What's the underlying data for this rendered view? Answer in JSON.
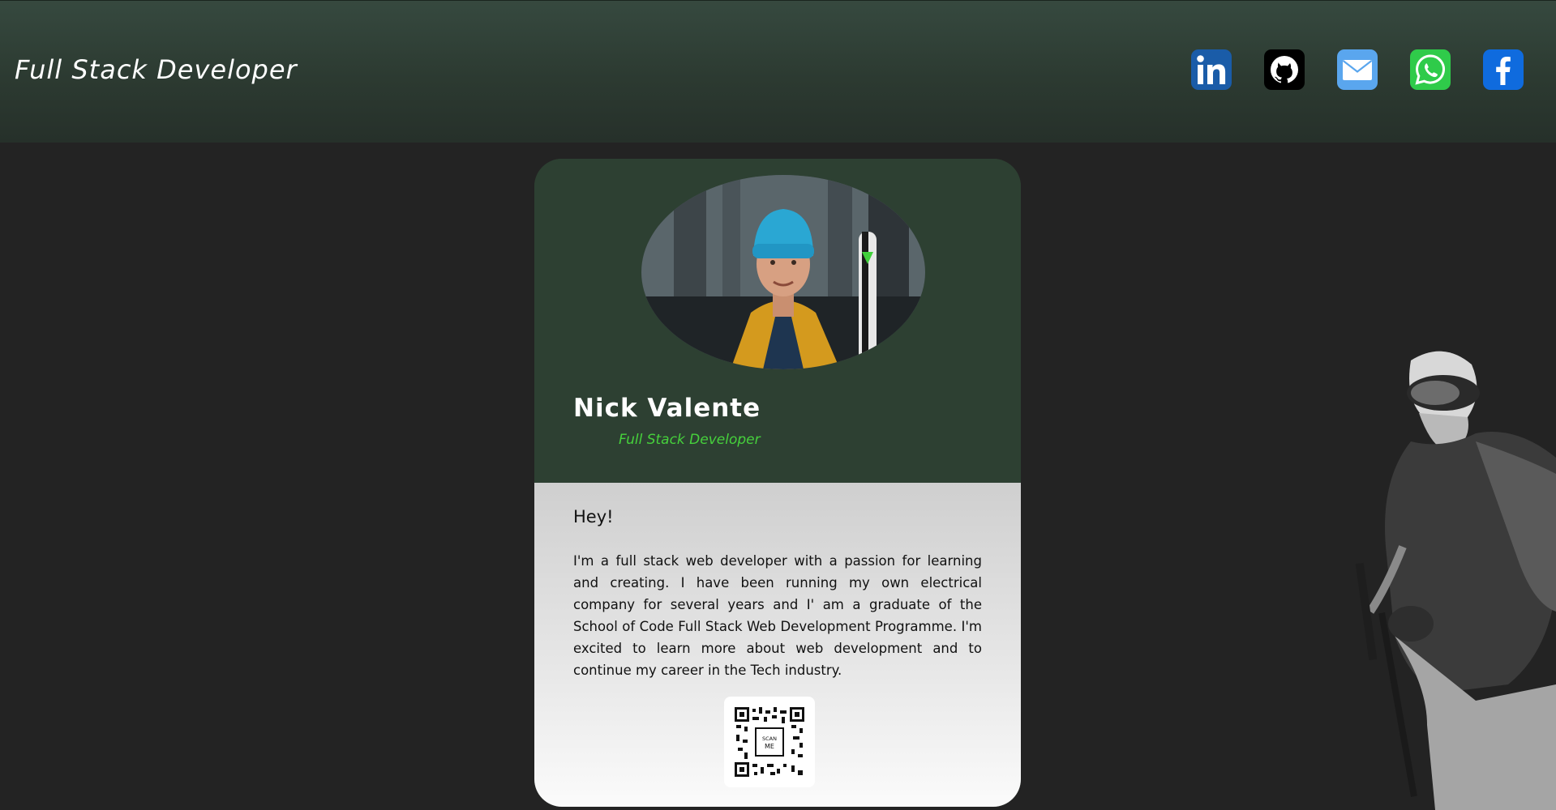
{
  "header": {
    "title": "Full Stack Developer",
    "socials": [
      {
        "name": "linkedin",
        "icon": "linkedin-icon",
        "color": "#1a5ca8"
      },
      {
        "name": "github",
        "icon": "github-icon",
        "color": "#000000"
      },
      {
        "name": "email",
        "icon": "mail-icon",
        "color": "#5aa6ee"
      },
      {
        "name": "whatsapp",
        "icon": "whatsapp-icon",
        "color": "#2fcb4a"
      },
      {
        "name": "facebook",
        "icon": "facebook-icon",
        "color": "#0f6bde"
      }
    ]
  },
  "card": {
    "name": "Nick Valente",
    "role": "Full Stack Developer",
    "greeting": "Hey!",
    "bio": "I'm a full stack web developer with a passion for learning and creating. I have been running my own electrical company for several years and I' am a graduate of the School of Code Full Stack Web Development Programme. I'm excited to learn more about web development and to continue my career in the Tech industry.",
    "qr_label": "SCAN ME"
  },
  "colors": {
    "background": "#232323",
    "header": "#2f3f35",
    "card_top": "#2d4032",
    "accent": "#46d13c"
  }
}
